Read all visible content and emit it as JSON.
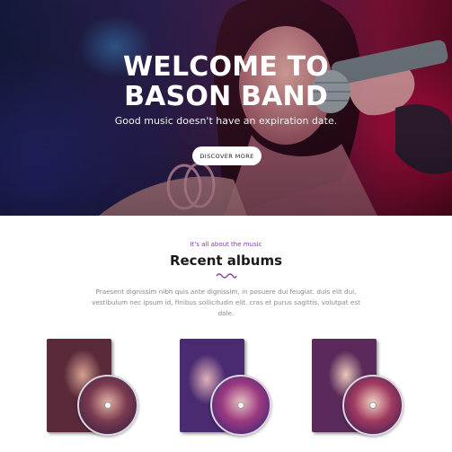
{
  "hero": {
    "title_line1": "WELCOME TO",
    "title_line2": "BASON BAND",
    "subtitle": "Good music doesn't have an expiration date.",
    "cta_label": "DISCOVER MORE"
  },
  "section": {
    "eyebrow": "It's all about the music",
    "title": "Recent albums",
    "description": "Praesent dignissim nibh quis ante dignissim, in posuere dui feugiat. duis elit dui, vestibulum nec ipsum id, finibus sollicitudin elit. cras et purus sagittis, volutpat est dole."
  },
  "albums": [
    {
      "name": "album-1"
    },
    {
      "name": "album-2"
    },
    {
      "name": "album-3"
    }
  ],
  "colors": {
    "accent": "#8a3ca8",
    "hero_red": "#c20a46",
    "hero_blue": "#1e2660"
  }
}
